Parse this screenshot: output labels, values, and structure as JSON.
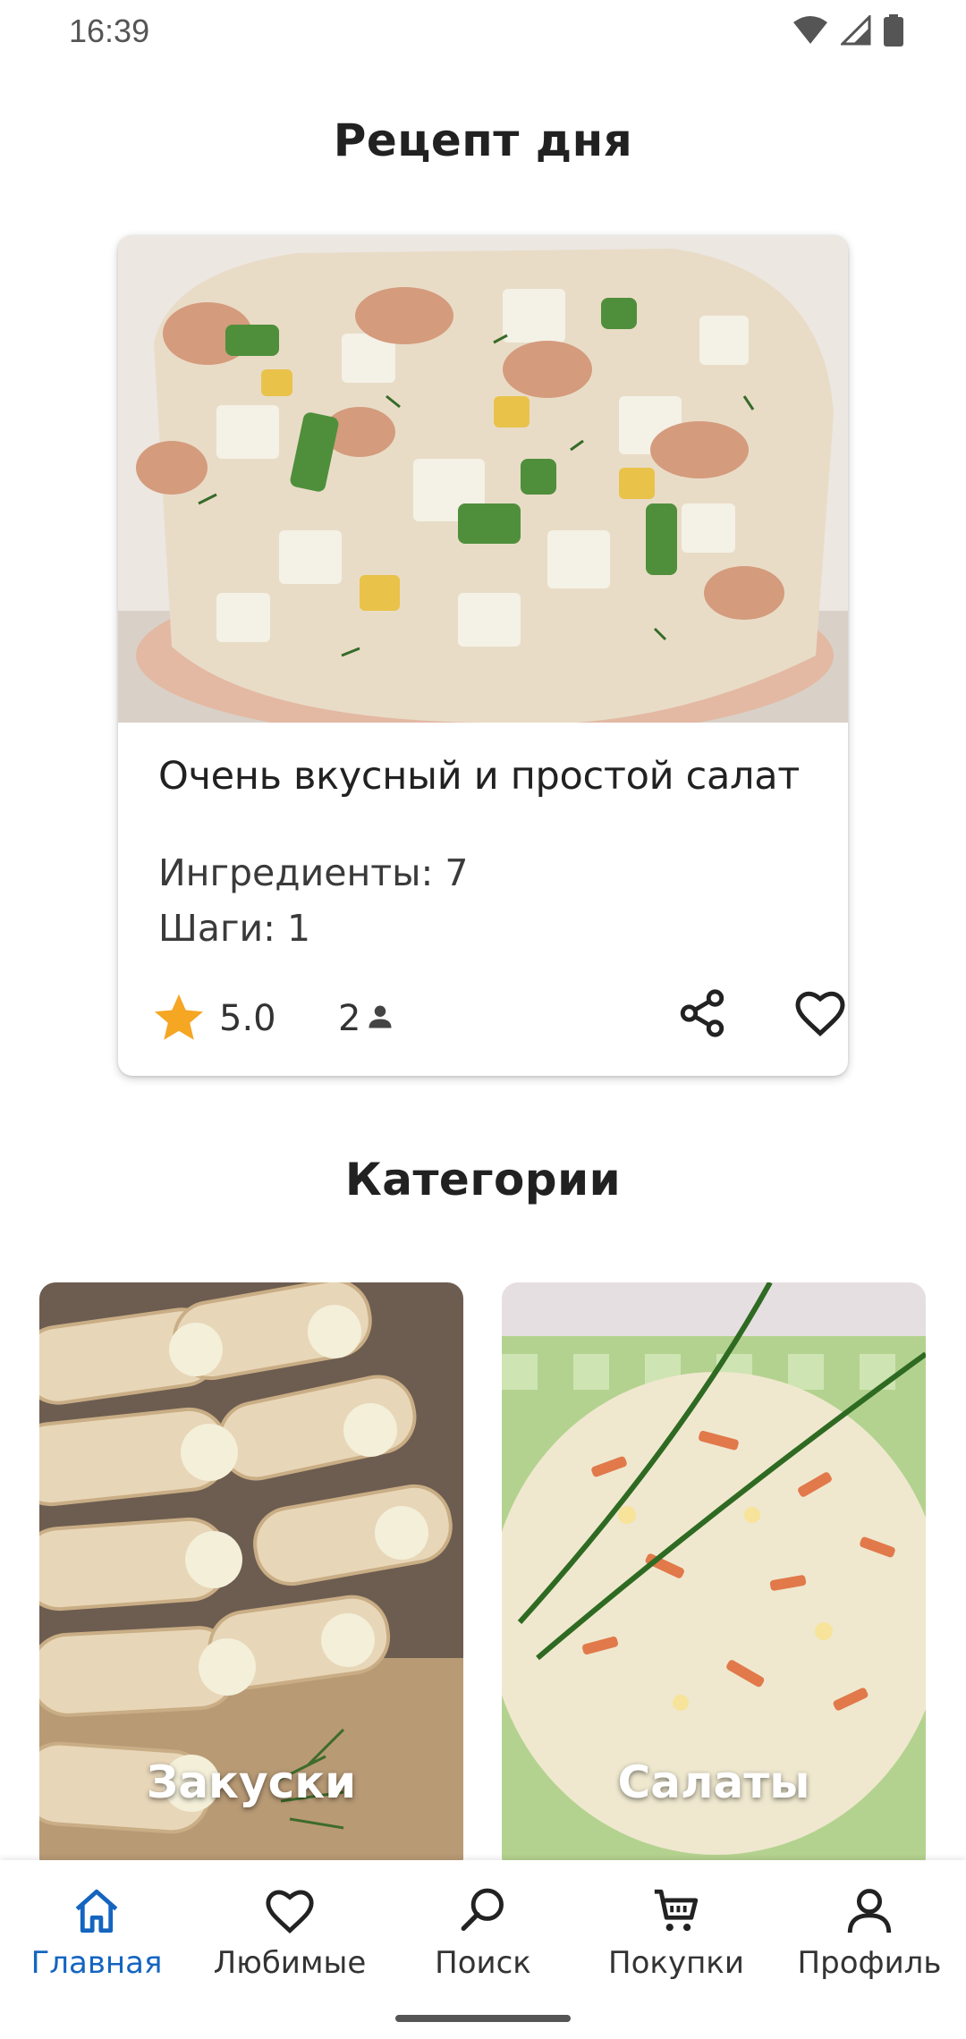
{
  "status_bar": {
    "time": "16:39"
  },
  "recipe_of_day": {
    "section_title": "Рецепт  дня",
    "name": "Очень вкусный и простой салат",
    "ingredients_text": "Ингредиенты: 7",
    "steps_text": "Шаги: 1",
    "rating": "5.0",
    "reviews": "2"
  },
  "categories": {
    "section_title": "Категории",
    "items": [
      {
        "label": "Закуски"
      },
      {
        "label": "Салаты"
      }
    ]
  },
  "bottom_nav": {
    "items": [
      {
        "label": "Главная",
        "icon": "home-icon",
        "active": true
      },
      {
        "label": "Любимые",
        "icon": "heart-icon"
      },
      {
        "label": "Поиск",
        "icon": "search-icon"
      },
      {
        "label": "Покупки",
        "icon": "cart-icon"
      },
      {
        "label": "Профиль",
        "icon": "profile-icon"
      }
    ]
  },
  "colors": {
    "accent": "#1565c0",
    "star": "#f5a623",
    "text": "#212121"
  }
}
